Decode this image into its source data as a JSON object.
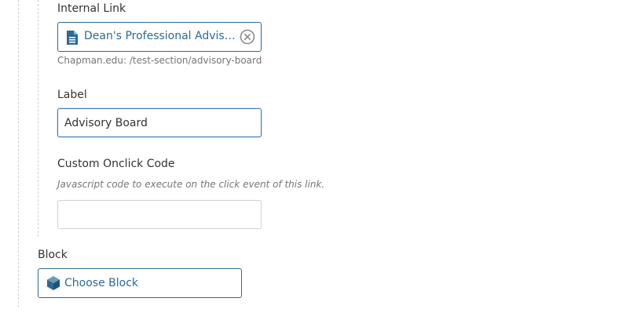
{
  "internal_link": {
    "label": "Internal Link",
    "selected_page": "Dean's Professional Advisory Board",
    "path": "Chapman.edu: /test-section/advisory-board"
  },
  "label_field": {
    "label": "Label",
    "value": "Advisory Board"
  },
  "custom_onclick": {
    "label": "Custom Onclick Code",
    "description": "Javascript code to execute on the click event of this link.",
    "value": ""
  },
  "block": {
    "label": "Block",
    "button_label": "Choose Block"
  },
  "colors": {
    "accent": "#2b6a95",
    "guide": "#cfcfcf",
    "muted_text": "#757575"
  },
  "icons": {
    "document": "document-icon",
    "clear": "clear-circle-x-icon",
    "block": "cube-icon"
  }
}
